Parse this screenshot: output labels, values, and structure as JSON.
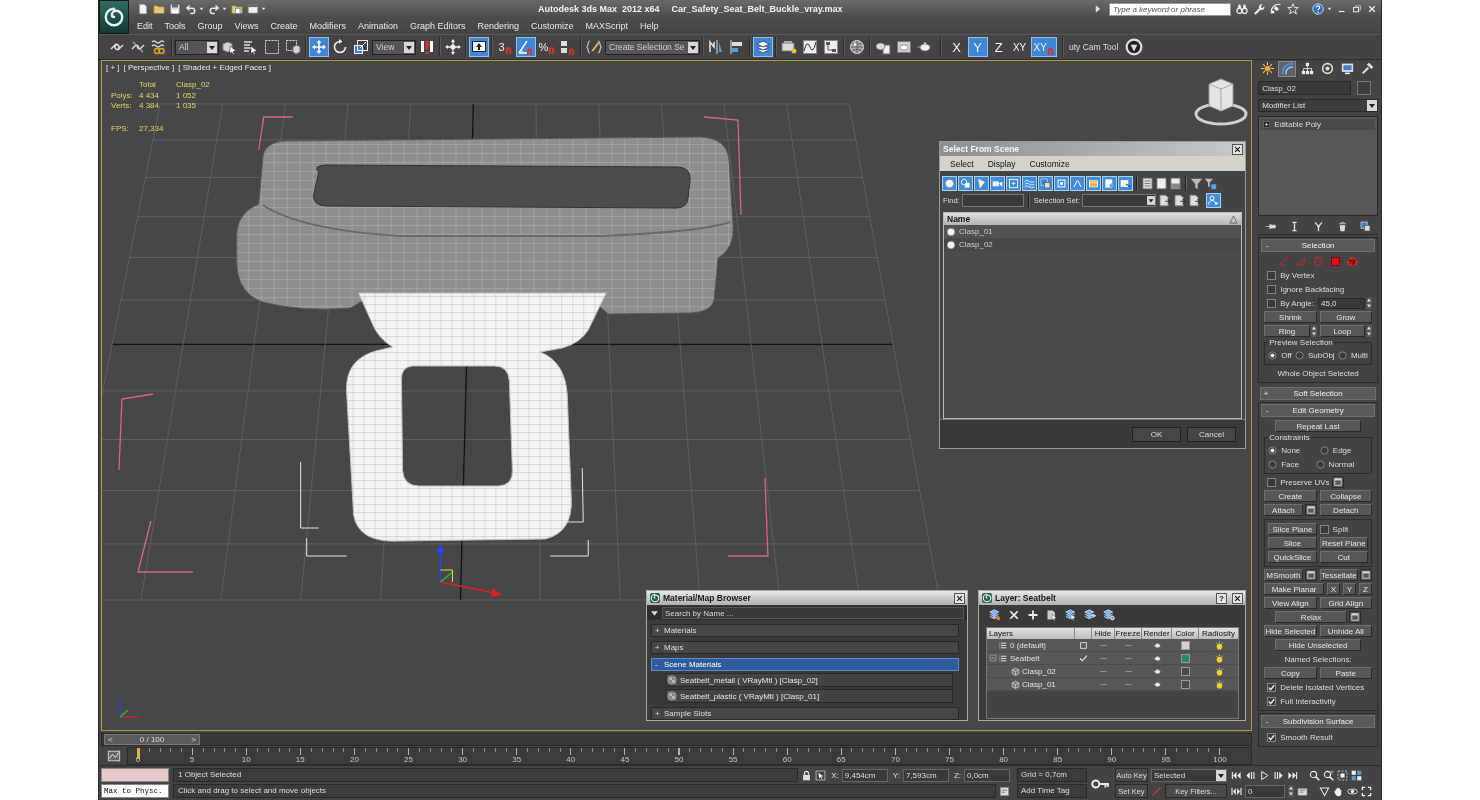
{
  "title_bar": {
    "app_title": "Autodesk 3ds Max  2012 x64",
    "file_name": "Car_Safety_Seat_Belt_Buckle_vray.max",
    "search": {
      "placeholder": "Type a keyword or phrase"
    }
  },
  "menu": [
    "Edit",
    "Tools",
    "Group",
    "Views",
    "Create",
    "Modifiers",
    "Animation",
    "Graph Editors",
    "Rendering",
    "Customize",
    "MAXScript",
    "Help"
  ],
  "main_toolbar": {
    "groups": [
      [
        {
          "kind": "icon",
          "selected": false
        },
        {
          "kind": "icon",
          "selected": false
        },
        {
          "kind": "icon",
          "selected": false
        }
      ],
      [
        {
          "kind": "dropdown",
          "value": "All"
        },
        {
          "kind": "icon",
          "selected": false
        },
        {
          "kind": "icon",
          "selected": false
        },
        {
          "kind": "icon",
          "selected": false
        },
        {
          "kind": "icon",
          "selected": false
        }
      ],
      [
        {
          "kind": "icon",
          "selected": true
        },
        {
          "kind": "icon",
          "selected": false
        },
        {
          "kind": "icon",
          "selected": false
        },
        {
          "kind": "dropdown",
          "value": "View"
        },
        {
          "kind": "icon",
          "selected": false
        }
      ],
      [
        {
          "kind": "icon",
          "selected": false
        }
      ],
      [
        {
          "kind": "icon",
          "selected": true
        }
      ],
      [
        {
          "kind": "snap",
          "label": "3",
          "selected": false
        },
        {
          "kind": "icon",
          "selected": true
        },
        {
          "kind": "snap",
          "label": "%",
          "selected": false
        },
        {
          "kind": "icon",
          "selected": false
        }
      ],
      [
        {
          "kind": "icon",
          "selected": false
        },
        {
          "kind": "dropdown",
          "value": "Create Selection Se"
        }
      ],
      [
        {
          "kind": "icon",
          "selected": false
        },
        {
          "kind": "icon",
          "selected": false
        }
      ],
      [
        {
          "kind": "icon",
          "selected": true
        }
      ],
      [
        {
          "kind": "icon",
          "selected": false
        },
        {
          "kind": "icon",
          "selected": false
        },
        {
          "kind": "icon",
          "selected": false
        }
      ],
      [
        {
          "kind": "icon",
          "selected": false
        }
      ],
      [
        {
          "kind": "icon",
          "selected": false
        },
        {
          "kind": "icon",
          "selected": false
        },
        {
          "kind": "icon",
          "selected": false
        }
      ]
    ],
    "axis_constraints": [
      {
        "kind": "axis",
        "label": "X",
        "selected": false
      },
      {
        "kind": "axis",
        "label": "Y",
        "selected": true
      },
      {
        "kind": "axis",
        "label": "Z",
        "selected": false
      },
      {
        "kind": "axis",
        "label": "XY",
        "selected": false
      },
      {
        "kind": "snap",
        "label": "XY",
        "selected": true
      }
    ],
    "tool_label": "uty Cam Tool"
  },
  "viewport": {
    "labels": [
      "[ + ]",
      "[ Perspective ]",
      "[ Shaded + Edged Faces ]"
    ],
    "stats": {
      "columns": [
        "Total",
        "Clasp_02"
      ],
      "rows": [
        {
          "label": "Polys:",
          "values": [
            "4 434",
            "1 052"
          ]
        },
        {
          "label": "Verts:",
          "values": [
            "4 384",
            "1 035"
          ]
        }
      ],
      "fps": {
        "label": "FPS:",
        "value": "27,334"
      }
    }
  },
  "select_from_scene": {
    "title": "Select From Scene",
    "menu": [
      "Select",
      "Display",
      "Customize"
    ],
    "filters": [
      {
        "selected": true
      },
      {
        "selected": true
      },
      {
        "selected": true
      },
      {
        "selected": true
      },
      {
        "selected": true
      },
      {
        "selected": true
      },
      {
        "selected": true
      },
      {
        "selected": true
      },
      {
        "selected": true
      },
      {
        "selected": true
      },
      {
        "selected": true
      },
      {
        "selected": true
      }
    ],
    "sync": {
      "selected": true
    },
    "find_label": "Find:",
    "set_label": "Selection Set:",
    "column": "Name",
    "objects": [
      "Clasp_01",
      "Clasp_02"
    ],
    "buttons": [
      "OK",
      "Cancel"
    ]
  },
  "material_browser": {
    "title": "Material/Map Browser",
    "search": {
      "placeholder": "Search by Name ..."
    },
    "groups": [
      {
        "sign": "+",
        "label": "Materials",
        "selected": false
      },
      {
        "sign": "+",
        "label": "Maps",
        "selected": false
      },
      {
        "sign": "-",
        "label": "Scene Materials",
        "selected": true,
        "items": [
          "Seatbelt_metall ( VRayMtl ) [Clasp_02]",
          "Seatbelt_plastic ( VRayMtl ) [Clasp_01]"
        ]
      },
      {
        "sign": "+",
        "label": "Sample Slots",
        "selected": false
      }
    ]
  },
  "layer_manager": {
    "title": "Layer: Seatbelt",
    "help": "?",
    "columns": [
      "Layers",
      "Hide",
      "Freeze",
      "Render",
      "Color",
      "Radiosity"
    ],
    "layers": [
      {
        "kind": "layer",
        "name": "0 (default)",
        "current": false,
        "hide": false,
        "freeze": false,
        "color": "#d0d0d0"
      },
      {
        "kind": "layer",
        "name": "Seatbelt",
        "current": true,
        "hide": false,
        "freeze": false,
        "color": "#1a8c74",
        "children": [
          {
            "kind": "object",
            "name": "Clasp_02",
            "hide": false,
            "freeze": false,
            "color": "#4a4a4a"
          },
          {
            "kind": "object",
            "name": "Clasp_01",
            "hide": false,
            "freeze": false,
            "color": "#4a4a4a"
          }
        ]
      }
    ]
  },
  "command_panel": {
    "tabs": [
      {
        "selected": false
      },
      {
        "selected": true
      },
      {
        "selected": false
      },
      {
        "selected": false
      },
      {
        "selected": false
      },
      {
        "selected": false
      }
    ],
    "object_name": "Clasp_02",
    "modifier_list": "Modifier List",
    "stack": [
      "Editable Poly"
    ],
    "rollouts": [
      {
        "sign": "-",
        "title": "Selection",
        "rows": [
          [
            {
              "kind": "subobject"
            }
          ],
          [
            {
              "kind": "checkbox",
              "label": "By Vertex",
              "checked": false
            }
          ],
          [
            {
              "kind": "checkbox",
              "label": "Ignore Backfacing",
              "checked": false
            }
          ],
          [
            {
              "kind": "checkbox",
              "label": "By Angle:",
              "checked": false,
              "value": "45,0"
            }
          ],
          [
            {
              "kind": "button",
              "label": "Shrink"
            },
            {
              "kind": "button",
              "label": "Grow"
            }
          ],
          [
            {
              "kind": "button",
              "label": "Ring",
              "spinner": true
            },
            {
              "kind": "button",
              "label": "Loop",
              "spinner": true
            }
          ],
          {
            "kind": "group",
            "label": "Preview Selection",
            "rows": [
              [
                {
                  "kind": "radio",
                  "label": "Off",
                  "selected": true
                },
                {
                  "kind": "radio",
                  "label": "SubObj",
                  "selected": false
                },
                {
                  "kind": "radio",
                  "label": "Multi",
                  "selected": false
                }
              ]
            ]
          },
          [
            {
              "kind": "text",
              "label": "Whole Object Selected"
            }
          ]
        ]
      },
      {
        "sign": "+",
        "title": "Soft Selection"
      },
      {
        "sign": "-",
        "title": "Edit Geometry",
        "rows": [
          [
            {
              "kind": "button",
              "label": "Repeat Last"
            }
          ],
          {
            "kind": "group",
            "label": "Constraints",
            "rows": [
              [
                {
                  "kind": "radio",
                  "label": "None",
                  "selected": true
                },
                {
                  "kind": "radio",
                  "label": "Edge",
                  "selected": false
                }
              ],
              [
                {
                  "kind": "radio",
                  "label": "Face",
                  "selected": false
                },
                {
                  "kind": "radio",
                  "label": "Normal",
                  "selected": false
                }
              ]
            ]
          },
          [
            {
              "kind": "checkbox",
              "label": "Preserve UVs",
              "checked": false,
              "settings": true
            }
          ],
          [
            {
              "kind": "button",
              "label": "Create"
            },
            {
              "kind": "button",
              "label": "Collapse"
            }
          ],
          [
            {
              "kind": "button",
              "label": "Attach",
              "settings": true
            },
            {
              "kind": "button",
              "label": "Detach"
            }
          ],
          {
            "kind": "group",
            "rows": [
              [
                {
                  "kind": "button",
                  "label": "Slice Plane"
                },
                {
                  "kind": "checkbox",
                  "label": "Split",
                  "checked": false
                }
              ],
              [
                {
                  "kind": "button",
                  "label": "Slice"
                },
                {
                  "kind": "button",
                  "label": "Reset Plane"
                }
              ],
              [
                {
                  "kind": "button",
                  "label": "QuickSlice"
                },
                {
                  "kind": "button",
                  "label": "Cut"
                }
              ]
            ]
          },
          [
            {
              "kind": "button",
              "label": "MSmooth",
              "settings": true
            },
            {
              "kind": "button",
              "label": "Tessellate",
              "settings": true
            }
          ],
          [
            {
              "kind": "button",
              "label": "Make Planar"
            },
            {
              "kind": "axis_button",
              "label": "X"
            },
            {
              "kind": "axis_button",
              "label": "Y"
            },
            {
              "kind": "axis_button",
              "label": "Z"
            }
          ],
          [
            {
              "kind": "button",
              "label": "View Align"
            },
            {
              "kind": "button",
              "label": "Grid Align"
            }
          ],
          [
            {
              "kind": "button",
              "label": "Relax",
              "settings": true
            }
          ],
          [
            {
              "kind": "button",
              "label": "Hide Selected"
            },
            {
              "kind": "button",
              "label": "Unhide All"
            }
          ],
          [
            {
              "kind": "button",
              "label": "Hide Unselected"
            }
          ],
          [
            {
              "kind": "caption",
              "label": "Named Selections:"
            }
          ],
          [
            {
              "kind": "button",
              "label": "Copy"
            },
            {
              "kind": "button",
              "label": "Paste"
            }
          ],
          [
            {
              "kind": "checkbox",
              "label": "Delete Isolated Vertices",
              "checked": true
            }
          ],
          [
            {
              "kind": "checkbox",
              "label": "Full Interactivity",
              "checked": true
            }
          ]
        ]
      },
      {
        "sign": "-",
        "title": "Subdivision Surface",
        "rows": [
          [
            {
              "kind": "checkbox",
              "label": "Smooth Result",
              "checked": true
            }
          ]
        ]
      }
    ]
  },
  "time_slider": {
    "previous": "<",
    "position": "0 / 100",
    "next": ">"
  },
  "track_bar": {
    "labels": [
      "0",
      "5",
      "10",
      "15",
      "20",
      "25",
      "30",
      "35",
      "40",
      "45",
      "50",
      "55",
      "60",
      "65",
      "70",
      "75",
      "80",
      "85",
      "90",
      "95",
      "100"
    ]
  },
  "status_bar": {
    "listener": "Max to Physc.",
    "selection": "1 Object Selected",
    "prompt": "Click and drag to select and move objects",
    "coords": [
      {
        "axis": "X:",
        "value": "9,454cm"
      },
      {
        "axis": "Y:",
        "value": "7,593cm"
      },
      {
        "axis": "Z:",
        "value": "0,0cm"
      }
    ],
    "grid": "Grid = 0,7cm",
    "time_tag": "Add Time Tag",
    "auto_key": "Auto Key",
    "key_set": "Selected",
    "set_key": "Set Key",
    "key_filters": "Key Filters..."
  },
  "animation": {
    "frame": "0"
  }
}
